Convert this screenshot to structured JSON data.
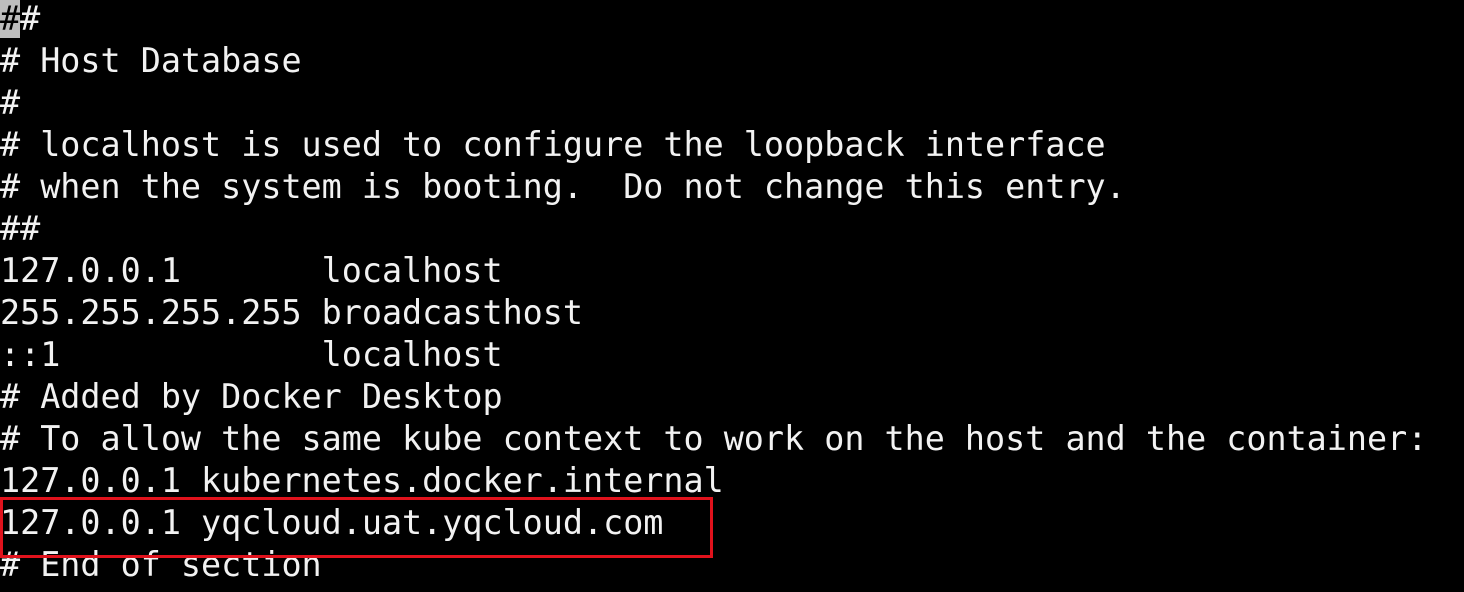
{
  "terminal": {
    "cursor_char": "#",
    "lines": [
      "#",
      "# Host Database",
      "#",
      "# localhost is used to configure the loopback interface",
      "# when the system is booting.  Do not change this entry.",
      "##",
      "127.0.0.1       localhost",
      "255.255.255.255 broadcasthost",
      "::1             localhost",
      "# Added by Docker Desktop",
      "# To allow the same kube context to work on the host and the container:",
      "127.0.0.1 kubernetes.docker.internal",
      "127.0.0.1 yqcloud.uat.yqcloud.com",
      "# End of section"
    ]
  },
  "colors": {
    "background": "#000000",
    "text": "#f2f2f2",
    "cursor": "#bdbdbd",
    "highlight_border": "#e0121c"
  }
}
